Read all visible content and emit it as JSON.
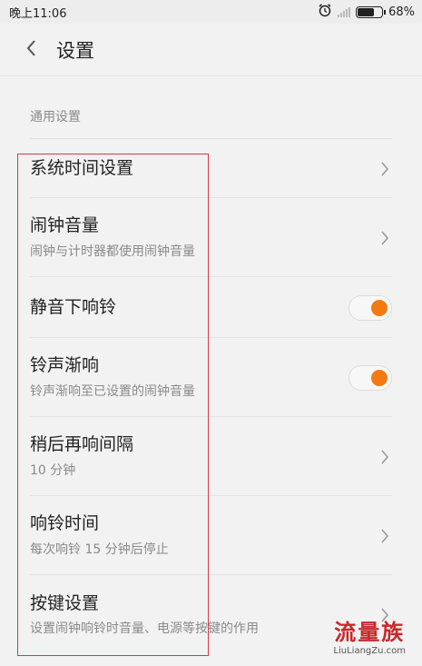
{
  "status_bar": {
    "time": "晚上11:06",
    "battery_percent": "68%",
    "battery_level": 0.68
  },
  "header": {
    "title": "设置"
  },
  "section": {
    "label": "通用设置"
  },
  "items": [
    {
      "title": "系统时间设置",
      "subtitle": "",
      "control": "chevron"
    },
    {
      "title": "闹钟音量",
      "subtitle": "闹钟与计时器都使用闹钟音量",
      "control": "chevron"
    },
    {
      "title": "静音下响铃",
      "subtitle": "",
      "control": "toggle",
      "on": true
    },
    {
      "title": "铃声渐响",
      "subtitle": "铃声渐响至已设置的闹钟音量",
      "control": "toggle",
      "on": true
    },
    {
      "title": "稍后再响间隔",
      "subtitle": "10 分钟",
      "control": "chevron"
    },
    {
      "title": "响铃时间",
      "subtitle": "每次响铃 15 分钟后停止",
      "control": "chevron"
    },
    {
      "title": "按键设置",
      "subtitle": "设置闹钟响铃时音量、电源等按键的作用",
      "control": "chevron"
    }
  ],
  "watermark": {
    "cn": "流量族",
    "en": "LiuLiangZu.com"
  },
  "colors": {
    "accent": "#f37a12",
    "highlight_box": "#d9383f"
  }
}
